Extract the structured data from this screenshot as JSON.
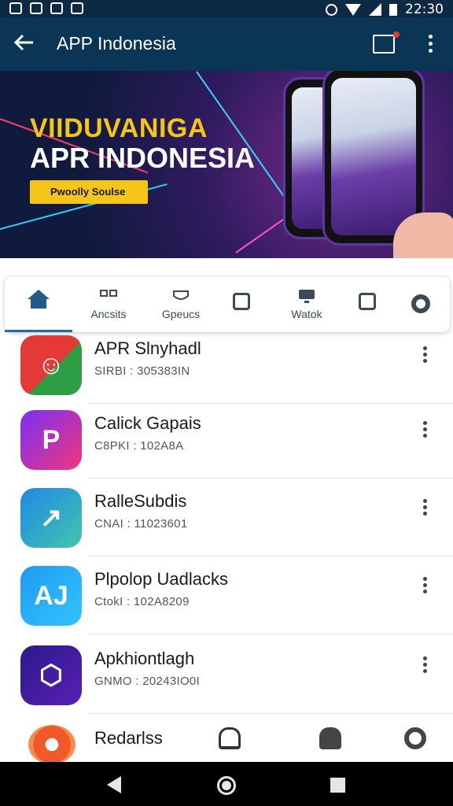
{
  "status_bar": {
    "time": "22:30"
  },
  "app_bar": {
    "title": "APP Indonesia"
  },
  "banner": {
    "headline_1": "VIIDUVANIGA",
    "headline_2": "APR INDONESIA",
    "cta_label": "Pwoolly Soulse"
  },
  "tabs": [
    {
      "label": "",
      "icon": "home-icon",
      "active": true
    },
    {
      "label": "Ancsits",
      "icon": "apps-icon"
    },
    {
      "label": "Gpeucs",
      "icon": "games-icon"
    },
    {
      "label": "",
      "icon": "store-icon"
    },
    {
      "label": "Watok",
      "icon": "watch-icon"
    },
    {
      "label": "",
      "icon": "list-icon"
    },
    {
      "label": "",
      "icon": "gear-icon"
    }
  ],
  "apps": [
    {
      "name": "APR Slnyhadl",
      "meta": "SIRBI : 305383IN",
      "icon": "red-smile-icon",
      "color_a": "#e53935",
      "color_b": "#2e9e44",
      "glyph": "☺"
    },
    {
      "name": "Calick Gapais",
      "meta": "C8PKI : 102A8A",
      "icon": "p-logo-icon",
      "color_a": "#7b2ff7",
      "color_b": "#f0367a",
      "glyph": "P"
    },
    {
      "name": "RalleSubdis",
      "meta": "CNAI : 11023601",
      "icon": "arrow-logo-icon",
      "color_a": "#1e88e5",
      "color_b": "#43c6ac",
      "glyph": "↗"
    },
    {
      "name": "Plpolop Uadlacks",
      "meta": "CtokI : 102A8209",
      "icon": "aj-logo-icon",
      "color_a": "#1e9bf0",
      "color_b": "#33c4ff",
      "glyph": "AJ"
    },
    {
      "name": "Apkhiontlagh",
      "meta": "GNMO : 20243IO0I",
      "icon": "hexagon-logo-icon",
      "color_a": "#2a1a8c",
      "color_b": "#5a1fb5",
      "glyph": "⬡"
    },
    {
      "name": "Redarlss",
      "meta": "",
      "icon": "target-logo-icon",
      "color_a": "#f05a28",
      "color_b": "#ff8a50",
      "glyph": "◎"
    }
  ],
  "colors": {
    "app_bar": "#0b3554",
    "accent": "#f5c518",
    "tab_active": "#1e6bb0"
  }
}
